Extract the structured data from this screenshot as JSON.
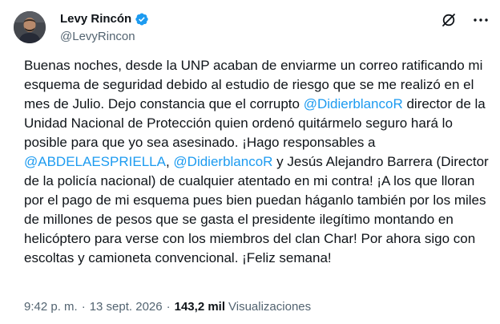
{
  "author": {
    "display_name": "Levy Rincón",
    "handle": "@LevyRincon",
    "verified": true
  },
  "tweet": {
    "segments": [
      {
        "type": "text",
        "text": "Buenas noches, desde la UNP acaban de enviarme un correo ratificando mi esquema de seguridad debido al estudio de riesgo que se me realizó en el mes de Julio. Dejo constancia que el corrupto "
      },
      {
        "type": "mention",
        "text": "@DidierblancoR"
      },
      {
        "type": "text",
        "text": " director de la Unidad Nacional de Protección quien ordenó quitármelo seguro hará lo posible para que yo sea asesinado. ¡Hago responsables a "
      },
      {
        "type": "mention",
        "text": "@ABDELAESPRIELLA"
      },
      {
        "type": "text",
        "text": ", "
      },
      {
        "type": "mention",
        "text": "@DidierblancoR"
      },
      {
        "type": "text",
        "text": " y Jesús Alejandro Barrera (Director de la policía nacional) de cualquier atentado en mi contra! ¡A los que lloran por el pago de mi esquema pues bien puedan háganlo también por los miles de millones de pesos que se gasta el presidente ilegítimo montando en helicóptero para verse con los miembros del clan Char! Por ahora sigo con escoltas y camioneta convencional. ¡Feliz semana!"
      }
    ]
  },
  "meta": {
    "time": "9:42 p. m.",
    "separator1": "·",
    "date": "13 sept. 2026",
    "separator2": "·",
    "views_count": "143,2 mil",
    "views_label": "Visualizaciones"
  },
  "icons": {
    "verified": "verified-badge-icon",
    "grok": "grok-icon",
    "more": "more-options-icon"
  },
  "colors": {
    "mention": "#1d9bf0",
    "verified_badge": "#1d9bf0",
    "secondary_text": "#536471",
    "primary_text": "#0f1419"
  }
}
